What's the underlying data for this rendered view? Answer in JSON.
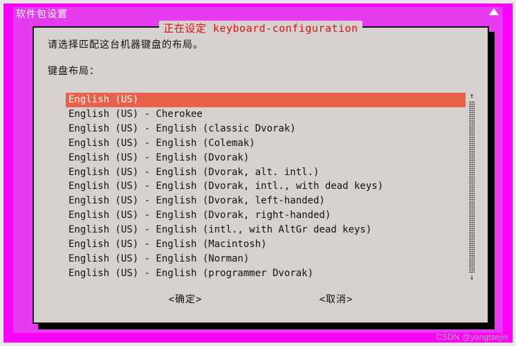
{
  "window": {
    "title": "软件包设置"
  },
  "dialog": {
    "title": "正在设定 keyboard-configuration",
    "prompt": "请选择匹配这台机器键盘的布局。",
    "section_label": "键盘布局：",
    "selected_index": 0,
    "items": [
      "English (US)",
      "English (US) - Cherokee",
      "English (US) - English (classic Dvorak)",
      "English (US) - English (Colemak)",
      "English (US) - English (Dvorak)",
      "English (US) - English (Dvorak, alt. intl.)",
      "English (US) - English (Dvorak, intl., with dead keys)",
      "English (US) - English (Dvorak, left-handed)",
      "English (US) - English (Dvorak, right-handed)",
      "English (US) - English (intl., with AltGr dead keys)",
      "English (US) - English (Macintosh)",
      "English (US) - English (Norman)",
      "English (US) - English (programmer Dvorak)"
    ],
    "ok_label": "<确定>",
    "cancel_label": "<取消>"
  },
  "watermark": "CSDN @yangtsejin"
}
